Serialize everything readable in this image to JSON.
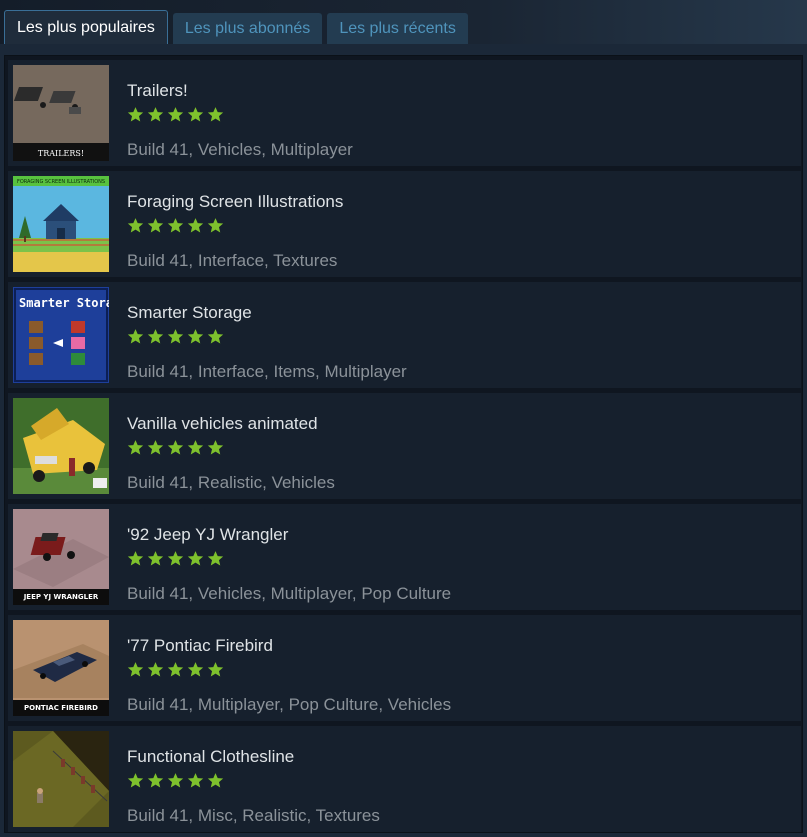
{
  "tabs": [
    {
      "label": "Les plus populaires",
      "active": true
    },
    {
      "label": "Les plus abonnés",
      "active": false
    },
    {
      "label": "Les plus récents",
      "active": false
    }
  ],
  "star_color": "#7ec12d",
  "items": [
    {
      "title": "Trailers!",
      "tags": "Build 41, Vehicles, Multiplayer",
      "rating": 5,
      "thumb_caption": "TRAILERS!"
    },
    {
      "title": "Foraging Screen Illustrations",
      "tags": "Build 41, Interface, Textures",
      "rating": 5,
      "thumb_caption": "FORAGING SCREEN  ILLUSTRATIONS"
    },
    {
      "title": "Smarter Storage",
      "tags": "Build 41, Interface, Items, Multiplayer",
      "rating": 5,
      "thumb_caption": "Smarter Storage"
    },
    {
      "title": "Vanilla vehicles animated",
      "tags": "Build 41, Realistic, Vehicles",
      "rating": 5,
      "thumb_caption": ""
    },
    {
      "title": "'92 Jeep YJ Wrangler",
      "tags": "Build 41, Vehicles, Multiplayer, Pop Culture",
      "rating": 5,
      "thumb_caption": "JEEP YJ WRANGLER"
    },
    {
      "title": "'77 Pontiac Firebird",
      "tags": "Build 41, Multiplayer, Pop Culture, Vehicles",
      "rating": 5,
      "thumb_caption": "PONTIAC FIREBIRD"
    },
    {
      "title": "Functional Clothesline",
      "tags": "Build 41, Misc, Realistic, Textures",
      "rating": 5,
      "thumb_caption": ""
    }
  ]
}
